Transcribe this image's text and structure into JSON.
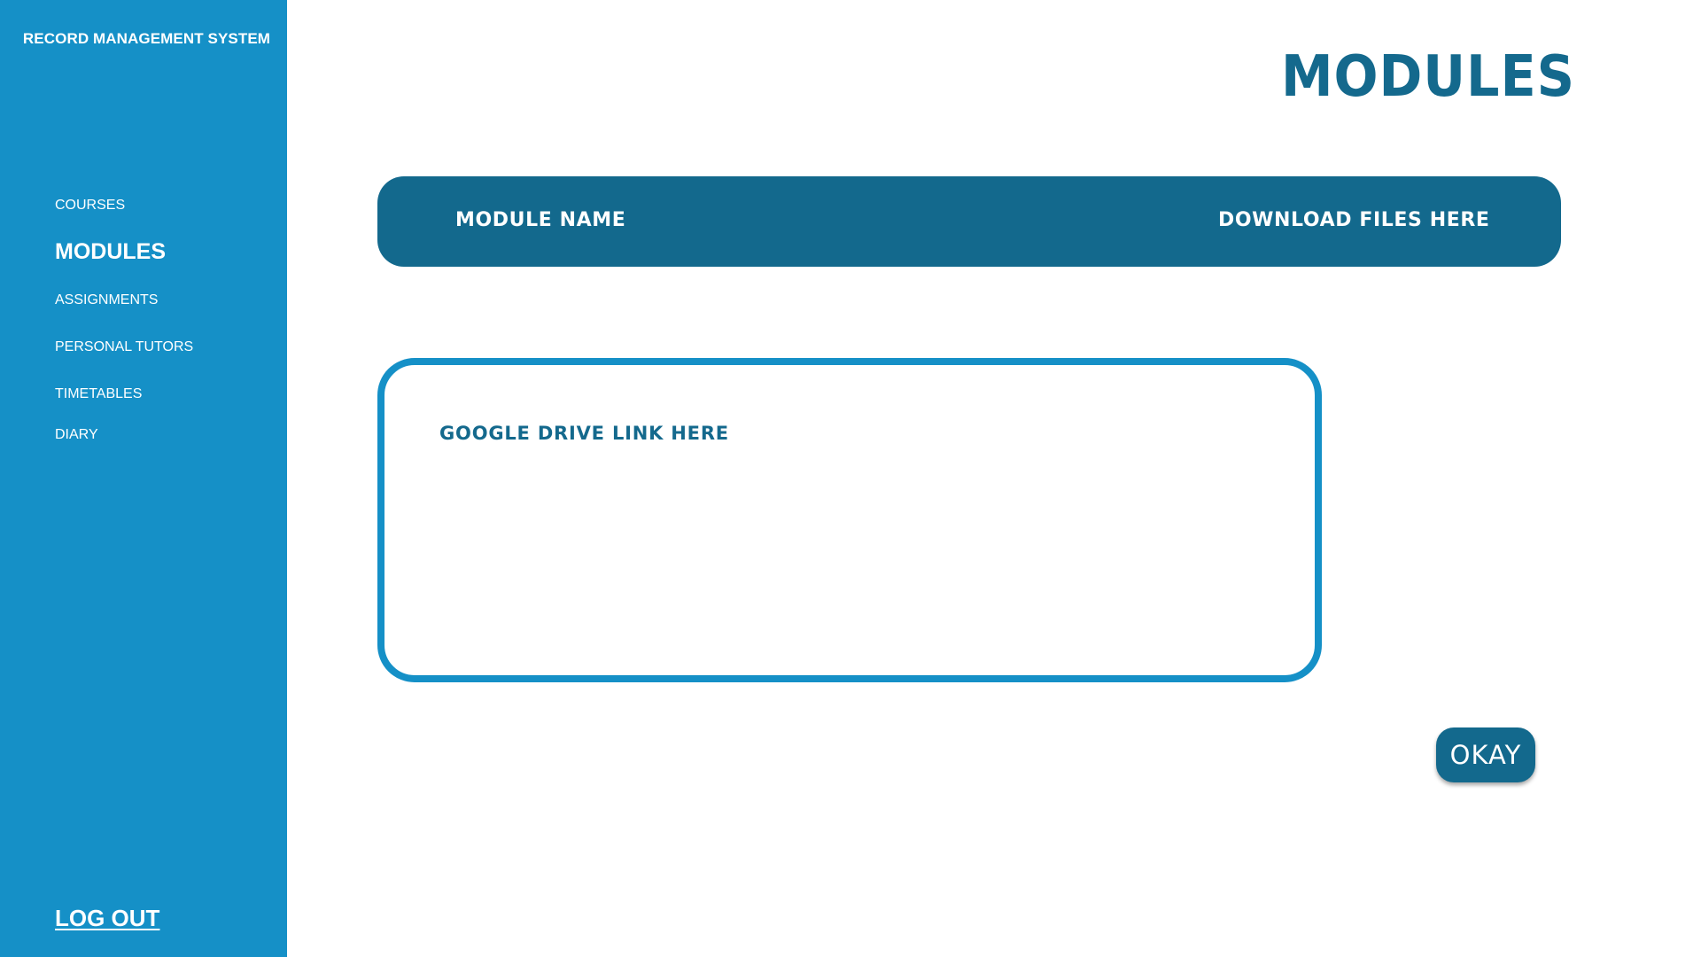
{
  "app": {
    "title": "RECORD MANAGEMENT SYSTEM"
  },
  "sidebar": {
    "items": [
      {
        "label": "COURSES",
        "active": false
      },
      {
        "label": "MODULES",
        "active": true
      },
      {
        "label": "ASSIGNMENTS",
        "active": false
      },
      {
        "label": "PERSONAL TUTORS",
        "active": false
      },
      {
        "label": "TIMETABLES",
        "active": false
      },
      {
        "label": "DIARY",
        "active": false
      }
    ],
    "logout_label": "LOG OUT"
  },
  "page": {
    "title": "MODULES"
  },
  "table": {
    "columns": [
      "MODULE NAME",
      "DOWNLOAD FILES HERE"
    ]
  },
  "link_box": {
    "placeholder": "GOOGLE DRIVE LINK HERE"
  },
  "actions": {
    "okay_label": "OKAY"
  },
  "colors": {
    "sidebar_background": "#1590c7",
    "primary_dark": "#13698d",
    "page_background": "#ffffff",
    "text_light": "#ffffff"
  }
}
